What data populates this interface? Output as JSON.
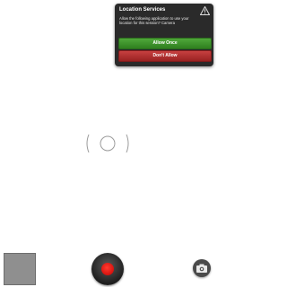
{
  "dialog": {
    "title": "Location Services",
    "message": "Allow the following application to use your location for this session? Camera",
    "allow_label": "Allow Once",
    "deny_label": "Don't Allow",
    "icon": "warning-icon",
    "colors": {
      "background": "#2a2a2a",
      "allow": "#3d9a2a",
      "deny": "#b53030"
    }
  },
  "camera": {
    "shutter_icon": "record-icon",
    "switch_icon": "camera-switch-icon",
    "focus_icon": "focus-reticle-icon",
    "shutter_color": "#e0201a"
  }
}
